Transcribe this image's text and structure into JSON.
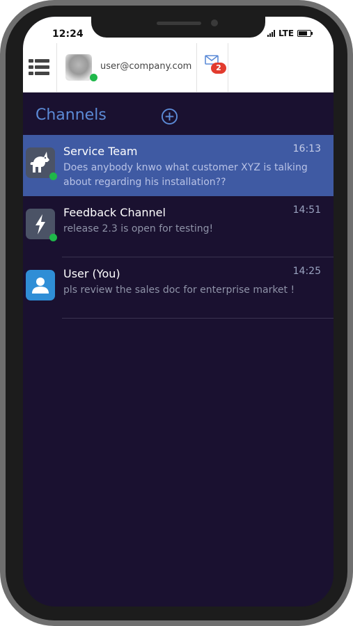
{
  "statusbar": {
    "time": "12:24",
    "network": "LTE"
  },
  "header": {
    "user_email": "user@company.com",
    "unread_count": "2"
  },
  "channels_title": "Channels",
  "channels": [
    {
      "name": "Service Team",
      "time": "16:13",
      "message": "Does anybody knwo what customer XYZ is talking about regarding his installation??",
      "icon": "unicorn-icon",
      "online": true,
      "active": true
    },
    {
      "name": "Feedback Channel",
      "time": "14:51",
      "message": "release 2.3 is open for testing!",
      "icon": "lightning-icon",
      "online": true,
      "active": false
    },
    {
      "name": "User (You)",
      "time": "14:25",
      "message": "pls review the sales doc for enterprise market !",
      "icon": "user-icon",
      "online": false,
      "active": false
    }
  ],
  "colors": {
    "accent": "#5c8bd7",
    "active_row": "#3f5aa3",
    "background": "#1a1130",
    "online": "#1fb84a",
    "badge": "#e23b2e"
  }
}
